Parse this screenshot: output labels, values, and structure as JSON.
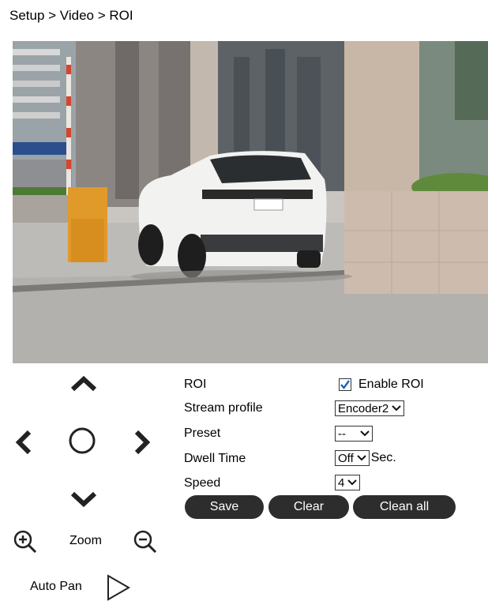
{
  "breadcrumb": "Setup > Video > ROI",
  "ptz": {
    "zoom_label": "Zoom",
    "autopan_label": "Auto Pan"
  },
  "settings": {
    "roi_label": "ROI",
    "enable_roi_label": "Enable ROI",
    "enable_roi_checked": true,
    "stream_profile_label": "Stream profile",
    "stream_profile_value": "Encoder2",
    "preset_label": "Preset",
    "preset_value": "--",
    "dwell_time_label": "Dwell Time",
    "dwell_time_value": "Off",
    "dwell_time_unit": "Sec.",
    "speed_label": "Speed",
    "speed_value": "4"
  },
  "buttons": {
    "save": "Save",
    "clear": "Clear",
    "clean_all": "Clean all"
  },
  "colors": {
    "button_bg": "#2d2d2d",
    "checkbox_check": "#1565c0"
  }
}
